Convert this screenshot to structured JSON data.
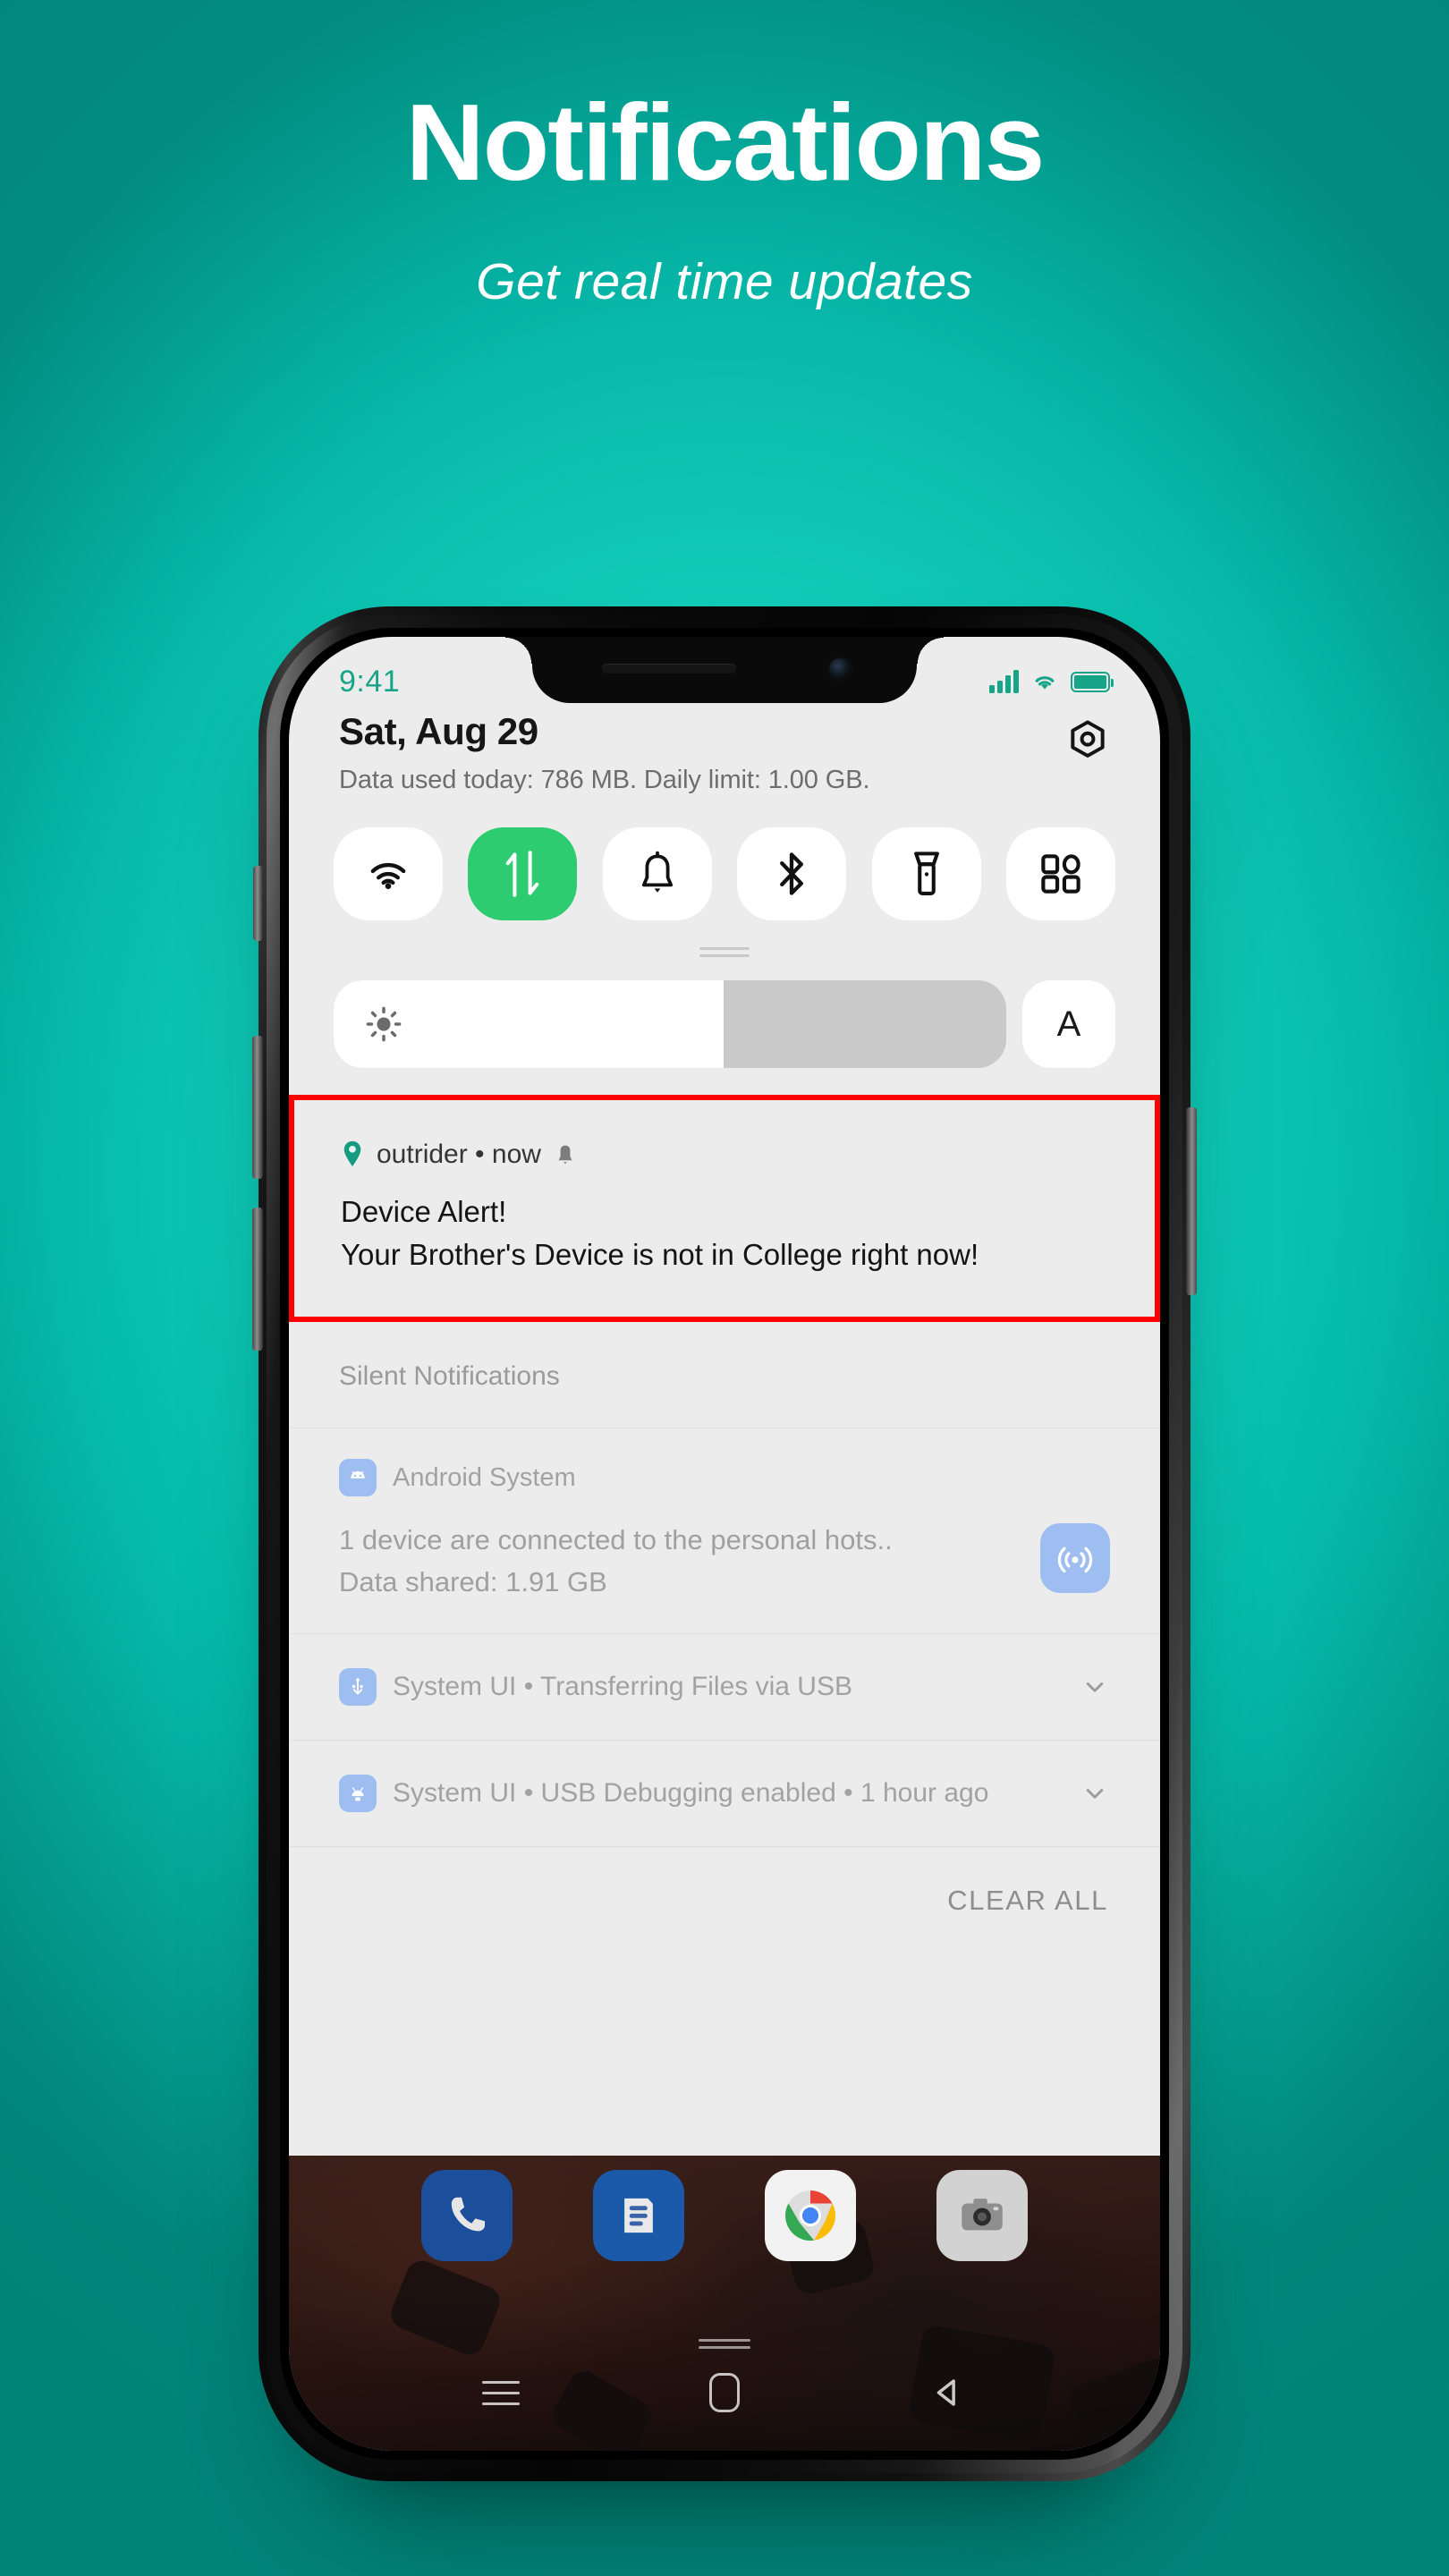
{
  "hero": {
    "title": "Notifications",
    "subtitle": "Get real time updates"
  },
  "colors": {
    "background_teal": "#06cfba",
    "background_teal_dark": "#029387",
    "accent_green": "#2ecc71",
    "status_teal": "#17a589",
    "highlight_red": "#ff0000",
    "screen_bg": "#ececec"
  },
  "phone": {
    "status_bar": {
      "time": "9:41",
      "signal_icon": "signal-bars-icon",
      "wifi_icon": "wifi-icon",
      "battery_icon": "battery-full-icon"
    },
    "panel_header": {
      "date": "Sat, Aug 29",
      "data_usage": "Data used today: 786 MB. Daily limit: 1.00 GB.",
      "settings_icon": "settings-gear-icon"
    },
    "quick_toggles": [
      {
        "name": "wifi",
        "icon": "wifi-icon",
        "active": false
      },
      {
        "name": "mobile-data",
        "icon": "mobile-data-icon",
        "active": true
      },
      {
        "name": "sound",
        "icon": "bell-icon",
        "active": false
      },
      {
        "name": "bluetooth",
        "icon": "bluetooth-icon",
        "active": false
      },
      {
        "name": "flashlight",
        "icon": "flashlight-icon",
        "active": false
      },
      {
        "name": "all-settings",
        "icon": "grid-apps-icon",
        "active": false
      }
    ],
    "brightness": {
      "icon": "brightness-sun-icon",
      "level_percent": 58,
      "auto_label": "A"
    },
    "highlighted_notification": {
      "app_icon": "location-pin-icon",
      "app_name": "outrider",
      "time": "now",
      "silent_icon": "bell-icon",
      "header_text": "outrider • now",
      "title": "Device Alert!",
      "body": "Your Brother's Device is not in College right now!"
    },
    "silent_section_label": "Silent Notifications",
    "silent_notifications": [
      {
        "app_icon": "android-robot-icon",
        "app_name": "Android System",
        "line1": "1 device are connected to the personal hots..",
        "line2": "Data shared: 1.91 GB",
        "trailing_icon": "hotspot-icon"
      }
    ],
    "compact_notifications": [
      {
        "app_icon": "usb-icon",
        "text": "System UI • Transferring Files via USB",
        "expand_icon": "chevron-down-icon"
      },
      {
        "app_icon": "android-debug-icon",
        "text": "System UI • USB Debugging enabled • 1 hour ago",
        "expand_icon": "chevron-down-icon"
      }
    ],
    "clear_all_label": "CLEAR ALL",
    "dock": [
      {
        "name": "phone",
        "icon": "phone-icon"
      },
      {
        "name": "messages",
        "icon": "messages-icon"
      },
      {
        "name": "chrome",
        "icon": "chrome-icon"
      },
      {
        "name": "camera",
        "icon": "camera-icon"
      }
    ],
    "navbar": [
      {
        "name": "recents",
        "icon": "recents-menu-icon"
      },
      {
        "name": "home",
        "icon": "home-square-icon"
      },
      {
        "name": "back",
        "icon": "back-triangle-icon"
      }
    ]
  }
}
